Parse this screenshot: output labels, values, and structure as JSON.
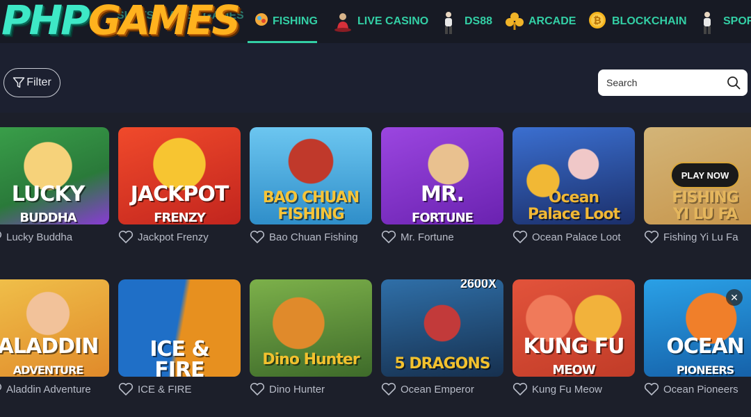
{
  "brand": {
    "logo_part1": "PHP",
    "logo_part2": "GAMES",
    "behind_logo": [
      "SLOTS",
      "GAMES",
      "GAMES"
    ]
  },
  "nav": {
    "items": [
      {
        "label": "FISHING",
        "icon": "fishing-icon",
        "active": true
      },
      {
        "label": "LIVE CASINO",
        "icon": "live-casino-icon"
      },
      {
        "label": "DS88",
        "icon": "ds88-icon"
      },
      {
        "label": "ARCADE",
        "icon": "clover-icon"
      },
      {
        "label": "BLOCKCHAIN",
        "icon": "bitcoin-icon"
      },
      {
        "label": "SPORTS",
        "icon": "sports-icon"
      }
    ]
  },
  "filter": {
    "label": "Filter"
  },
  "search": {
    "placeholder": "Search"
  },
  "games": [
    {
      "name": "Lucky Buddha",
      "thumb_text": "LUCKY",
      "thumb_sub": "BUDDHA",
      "colors": [
        "#3aa04a",
        "#f2c14e"
      ]
    },
    {
      "name": "Jackpot Frenzy",
      "thumb_text": "JACKPOT",
      "thumb_sub": "FRENZY",
      "colors": [
        "#e0452b",
        "#f7b32b"
      ]
    },
    {
      "name": "Bao Chuan Fishing",
      "thumb_text": "BAO CHUAN",
      "thumb_sub": "FISHING",
      "colors": [
        "#4fb3e8",
        "#f0c040"
      ]
    },
    {
      "name": "Mr. Fortune",
      "thumb_text": "MR.",
      "thumb_sub": "FORTUNE",
      "colors": [
        "#8a3bd6",
        "#e8a52e"
      ]
    },
    {
      "name": "Ocean Palace Loot",
      "thumb_text": "Ocean",
      "thumb_sub": "Palace Loot",
      "colors": [
        "#2e5fb8",
        "#f1b835"
      ]
    },
    {
      "name": "Fishing Yi Lu Fa",
      "thumb_text": "FISHING",
      "thumb_sub": "YI LU FA",
      "colors": [
        "#e9b65a",
        "#f6d27c"
      ],
      "hover_label": "PLAY NOW"
    },
    {
      "name": "Aladdin Adventure",
      "thumb_text": "ALADDIN",
      "thumb_sub": "ADVENTURE",
      "colors": [
        "#e0a63a",
        "#b0412d"
      ]
    },
    {
      "name": "ICE & FIRE",
      "thumb_text": "ICE &",
      "thumb_sub": "FIRE",
      "colors": [
        "#1f6fc7",
        "#e78b1f"
      ]
    },
    {
      "name": "Dino Hunter",
      "thumb_text": "Dino Hunter",
      "thumb_sub": "",
      "colors": [
        "#d98a2b",
        "#5a8f3a"
      ]
    },
    {
      "name": "Ocean Emperor",
      "thumb_text": "5 DRAGONS",
      "thumb_sub": "2600X",
      "colors": [
        "#1f3f6a",
        "#c23a3a"
      ]
    },
    {
      "name": "Kung Fu Meow",
      "thumb_text": "KUNG FU",
      "thumb_sub": "MEOW",
      "colors": [
        "#e2533b",
        "#f2a83b"
      ]
    },
    {
      "name": "Ocean Pioneers",
      "thumb_text": "OCEAN",
      "thumb_sub": "PIONEERS",
      "colors": [
        "#1f8fd6",
        "#f07f2a"
      ],
      "close_label": "✕"
    }
  ]
}
